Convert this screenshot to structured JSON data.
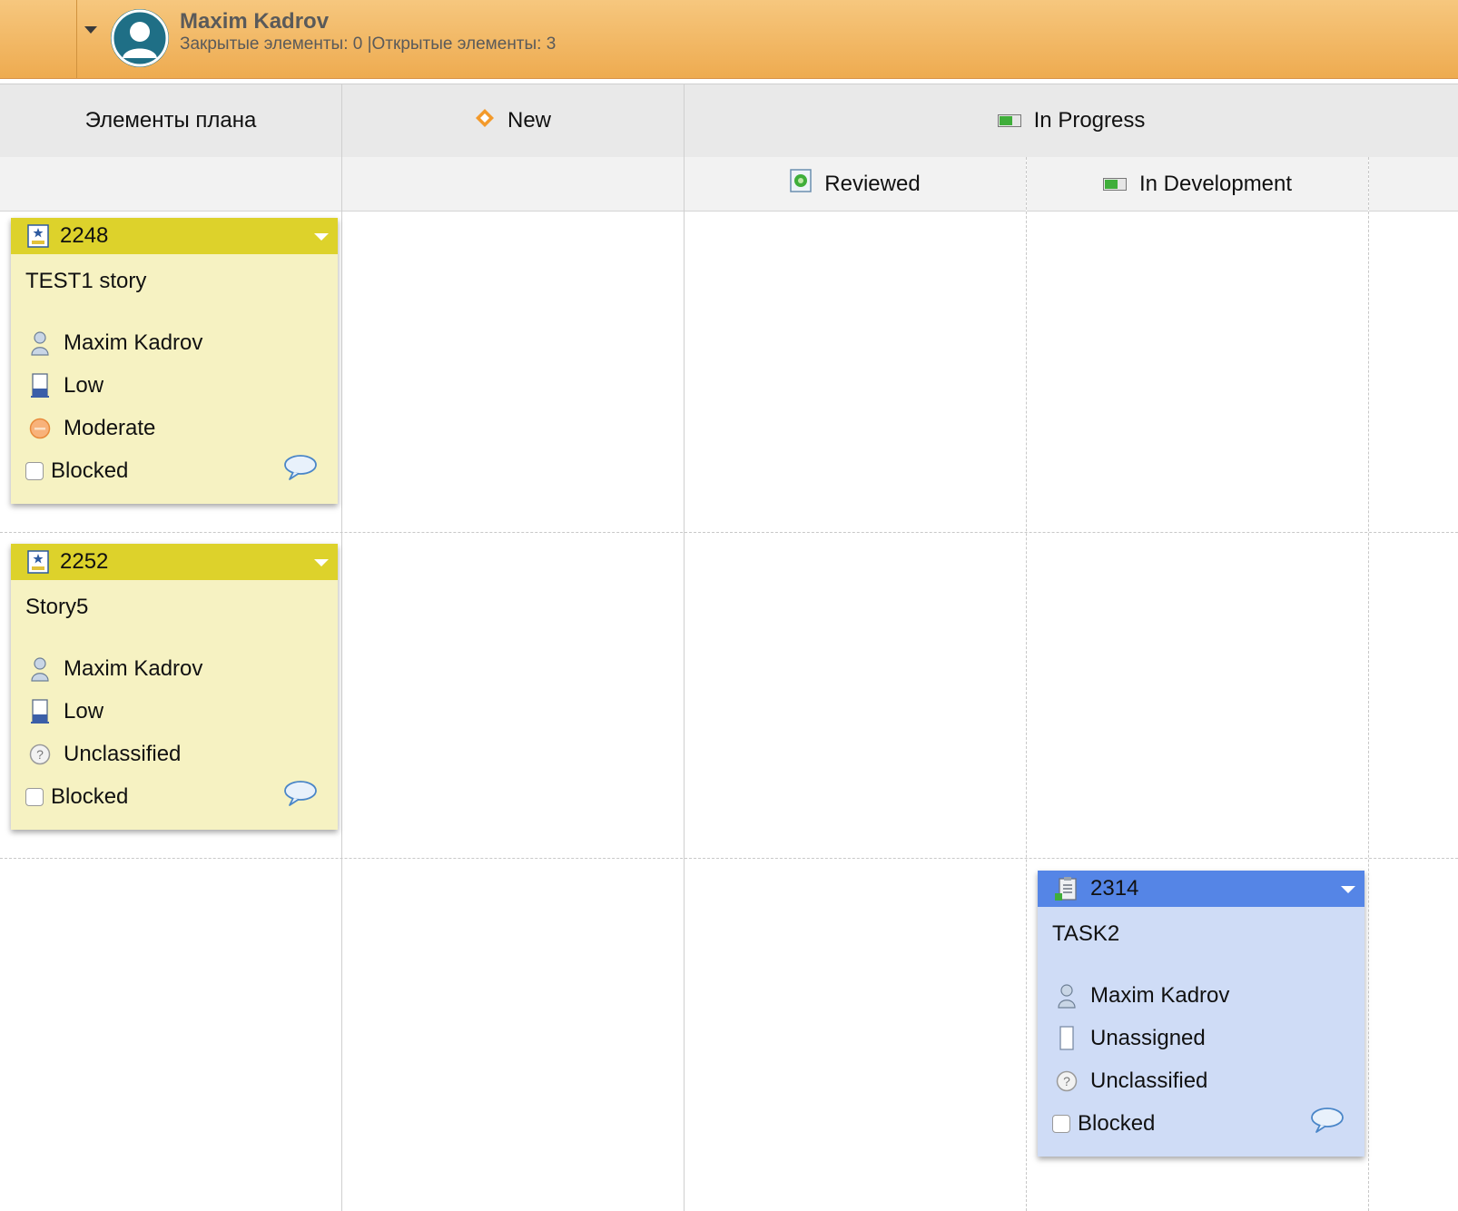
{
  "swimlane": {
    "user_name": "Maxim Kadrov",
    "stats": "Закрытые элементы: 0 |Открытые элементы: 3"
  },
  "columns": {
    "plan_items": "Элементы плана",
    "new": "New",
    "in_progress": "In Progress",
    "reviewed": "Reviewed",
    "in_development": "In Development"
  },
  "colors": {
    "story_header": "#ddd22b",
    "story_body": "#f6f2c2",
    "task_header": "#5585e6",
    "task_body": "#cfdcf6",
    "swimlane_bar": "#eeab50"
  },
  "cards": [
    {
      "type": "story",
      "type_icon": "story-icon",
      "id": "2248",
      "title": "TEST1 story",
      "owner": "Maxim Kadrov",
      "priority": "Low",
      "priority_icon": "priority-low-icon",
      "risk": "Moderate",
      "risk_icon": "risk-moderate-icon",
      "blocked_label": "Blocked",
      "blocked": false,
      "column": "Элементы плана"
    },
    {
      "type": "story",
      "type_icon": "story-icon",
      "id": "2252",
      "title": "Story5",
      "owner": "Maxim Kadrov",
      "priority": "Low",
      "priority_icon": "priority-low-icon",
      "risk": "Unclassified",
      "risk_icon": "question-icon",
      "blocked_label": "Blocked",
      "blocked": false,
      "column": "Элементы плана"
    },
    {
      "type": "task",
      "type_icon": "task-icon",
      "id": "2314",
      "title": "TASK2",
      "owner": "Maxim Kadrov",
      "priority": "Unassigned",
      "priority_icon": "priority-unassigned-icon",
      "risk": "Unclassified",
      "risk_icon": "question-icon",
      "blocked_label": "Blocked",
      "blocked": false,
      "column": "In Development"
    }
  ]
}
